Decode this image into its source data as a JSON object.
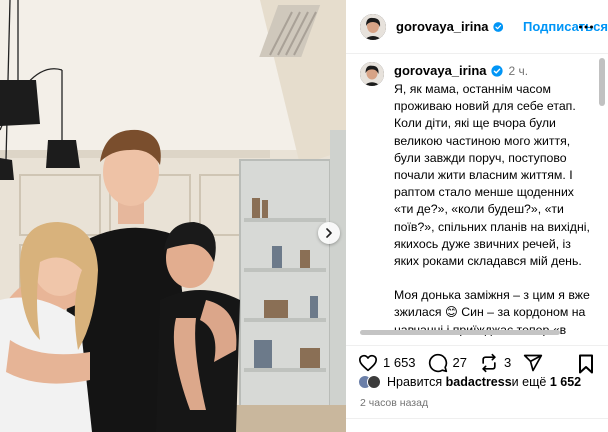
{
  "post": {
    "username": "gorovaya_irina",
    "verified": true,
    "follow_label": "Подписаться",
    "caption_author": "gorovaya_irina",
    "caption_time": "2 ч.",
    "caption_paragraph1": "Я, як мама, останнім часом проживаю новий для себе етап.\nКоли діти, які ще вчора були великою частиною мого життя, були завжди поруч, поступово почали жити власним життям. І раптом стало менше щоденних «ти де?», «коли будеш?», «ти поїв?», спільних планів на вихідні, якихось дуже звичних речей, із яких роками складався мій день.",
    "caption_paragraph2_a": "Моя донька заміжня – з цим я вже зжилася ",
    "caption_paragraph2_emoji": "😊",
    "caption_paragraph2_b": " Син – за кордоном на навчанні і приїжджає тепер «в гості». Звісно, з ними дуже пишаюся, дуже їх люблю, і саме цього для них й хотіла. Але вдавати, що прийняття їхнього дорослішання та самостійності",
    "likes_count": "1 653",
    "comments_count": "27",
    "reposts_count": "3",
    "liked_by_prefix": "Нравится ",
    "liked_by_user": "badactress",
    "liked_by_suffix": " и ещё ",
    "liked_by_others": "1 652",
    "timestamp": "2 часов назад"
  },
  "icons": {
    "more": "more-horizontal-icon",
    "heart": "heart-icon",
    "comment": "comment-icon",
    "repost": "repost-icon",
    "share": "send-icon",
    "bookmark": "bookmark-icon",
    "next": "chevron-right-icon"
  },
  "colors": {
    "link": "#0095f6",
    "verified": "#0095f6",
    "muted": "#737373"
  }
}
